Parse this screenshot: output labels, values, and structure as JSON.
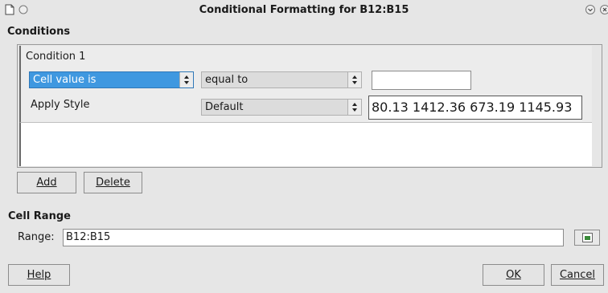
{
  "window": {
    "title": "Conditional Formatting for B12:B15"
  },
  "conditions": {
    "section_title": "Conditions",
    "condition_label": "Condition 1",
    "type_combo_value": "Cell value is",
    "operator_combo_value": "equal to",
    "value_input": "",
    "apply_style_label": "Apply Style",
    "style_combo_value": "Default",
    "preview_text": "80.13 1412.36 673.19 1145.93"
  },
  "buttons": {
    "add_label": "Add",
    "delete_label": "Delete",
    "help_label": "Help",
    "ok_label": "OK",
    "cancel_label": "Cancel"
  },
  "cell_range": {
    "section_title": "Cell Range",
    "range_label": "Range:",
    "range_value": "B12:B15"
  },
  "icons": {
    "window_icon": "document-icon",
    "shade_icon": "circle-icon",
    "minimize_icon": "chevron-down-circle-icon",
    "close_icon": "close-icon",
    "shrink_icon": "shrink-range-icon"
  }
}
